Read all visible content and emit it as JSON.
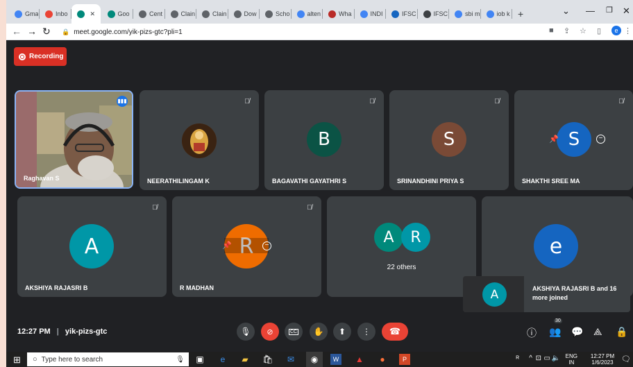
{
  "browser": {
    "tabs": [
      {
        "label": "Gmai",
        "icon": "google-icon",
        "color": "#4285f4"
      },
      {
        "label": "Inbo",
        "icon": "gmail-icon",
        "color": "#ea4335"
      },
      {
        "label": "",
        "icon": "meet-icon",
        "color": "#00897b",
        "active": true
      },
      {
        "label": "Goo",
        "icon": "meet-icon",
        "color": "#00897b"
      },
      {
        "label": "Cent",
        "icon": "globe-icon",
        "color": "#5f6368"
      },
      {
        "label": "Clain",
        "icon": "globe-icon",
        "color": "#5f6368"
      },
      {
        "label": "Clain",
        "icon": "globe-icon",
        "color": "#5f6368"
      },
      {
        "label": "Dow",
        "icon": "globe-icon",
        "color": "#5f6368"
      },
      {
        "label": "Scho",
        "icon": "globe-icon",
        "color": "#5f6368"
      },
      {
        "label": "alten",
        "icon": "google-icon",
        "color": "#4285f4"
      },
      {
        "label": "Wha",
        "icon": "quora-icon",
        "color": "#b92b27"
      },
      {
        "label": "INDI",
        "icon": "google-icon",
        "color": "#4285f4"
      },
      {
        "label": "IFSC",
        "icon": "ifsc-icon",
        "color": "#1565c0"
      },
      {
        "label": "IFSC",
        "icon": "ifsc-dark-icon",
        "color": "#3c4043"
      },
      {
        "label": "sbi m",
        "icon": "google-icon",
        "color": "#4285f4"
      },
      {
        "label": "iob k",
        "icon": "google-icon",
        "color": "#4285f4"
      }
    ],
    "new_tab": "+",
    "url": "meet.google.com/yik-pizs-gtc?pli=1",
    "profile_initial": "e"
  },
  "meeting": {
    "recording_label": "Recording",
    "time": "12:27 PM",
    "code": "yik-pizs-gtc",
    "people_count": "30"
  },
  "participants": [
    {
      "name": "Raghavan S"
    },
    {
      "name": "NEERATHILINGAM K"
    },
    {
      "name": "BAGAVATHI GAYATHRI S",
      "initial": "B",
      "color": "#0b5345"
    },
    {
      "name": "SRINANDHINI PRIYA S",
      "initial": "S",
      "color": "#7a4a36"
    },
    {
      "name": "SHAKTHI SREE MA",
      "initial": "S",
      "color": "#1565c0"
    },
    {
      "name": "AKSHIYA RAJASRI B",
      "initial": "A",
      "color": "#0097a7"
    },
    {
      "name": "R MADHAN",
      "initial": "R",
      "color": "#ef6c00"
    },
    {
      "name": "22 others",
      "initial1": "A",
      "initial2": "R",
      "color1": "#00897b",
      "color2": "#0097a7"
    },
    {
      "initial": "e",
      "color": "#1565c0"
    }
  ],
  "toast": {
    "initial": "A",
    "text": "AKSHIYA RAJASRI B and 16 more joined"
  },
  "taskbar": {
    "search_placeholder": "Type here to search",
    "lang": "ENG",
    "region": "IN",
    "time": "12:27 PM",
    "date": "1/6/2023"
  }
}
